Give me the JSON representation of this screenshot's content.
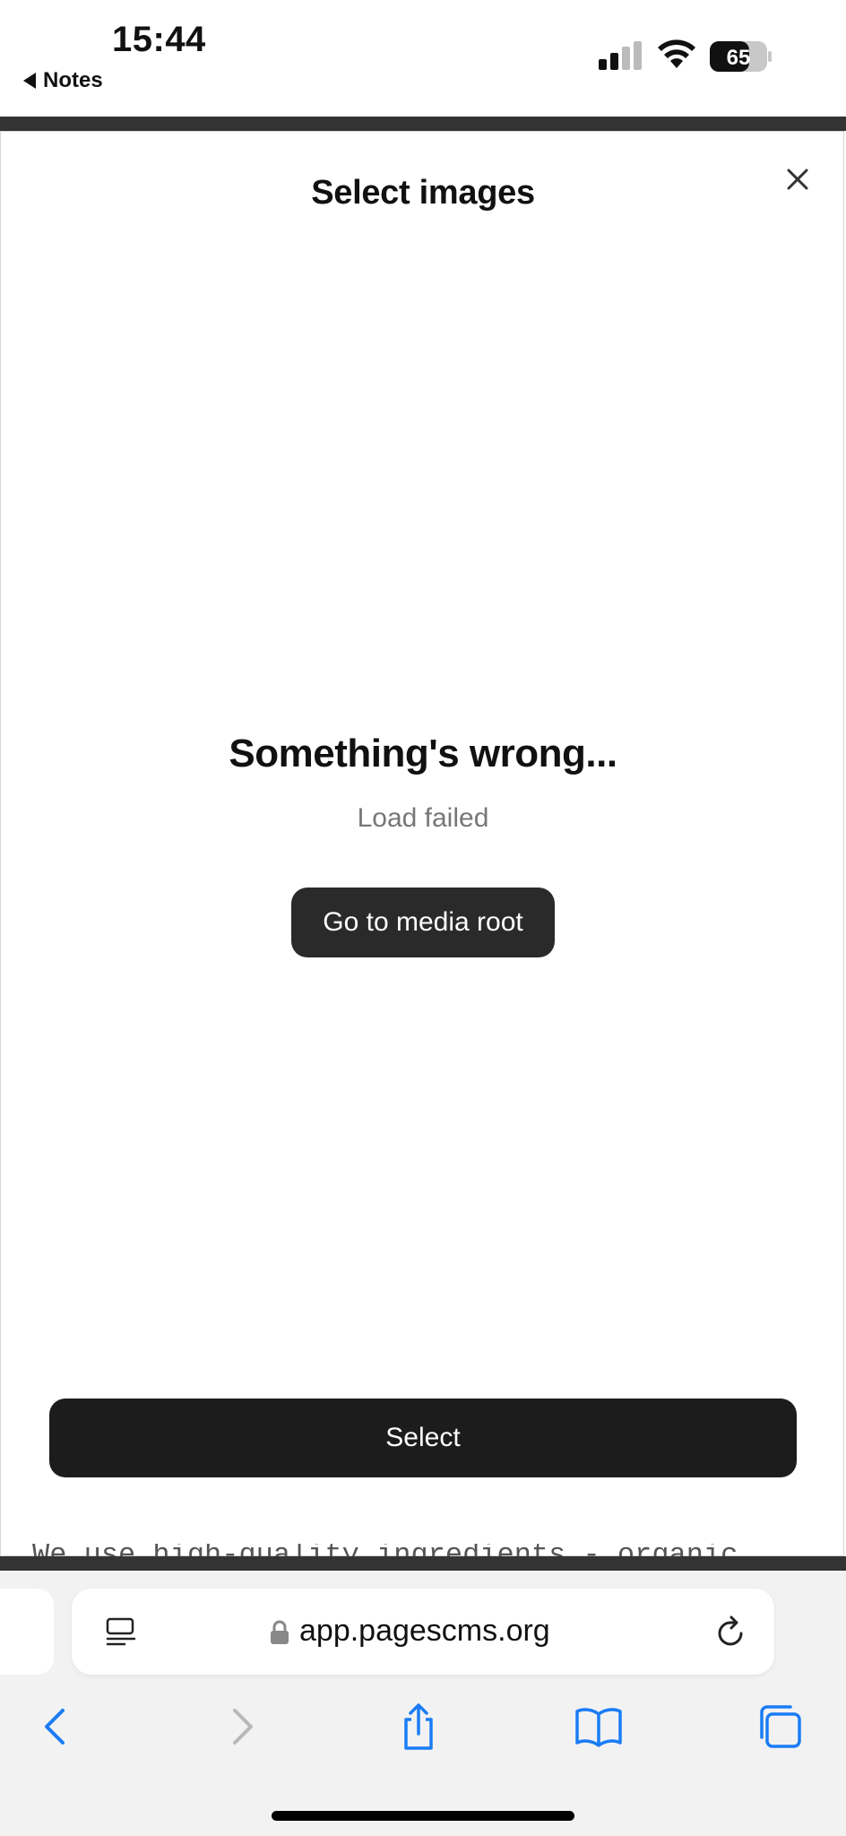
{
  "status": {
    "time": "15:44",
    "back_label": "Notes",
    "battery": "65"
  },
  "modal": {
    "title": "Select images",
    "error_title": "Something's wrong...",
    "error_message": "Load failed",
    "media_root_label": "Go to media root",
    "select_label": "Select"
  },
  "background": {
    "peek_text": "We use high-quality ingredients - organic"
  },
  "browser": {
    "url": "app.pagescms.org"
  },
  "colors": {
    "accent": "#1a7cf5",
    "button_dark": "#1c1c1c"
  },
  "icons": {
    "close": "close-icon",
    "reader": "reader-icon",
    "lock": "lock-icon",
    "reload": "reload-icon",
    "back": "back-arrow-icon",
    "forward": "forward-arrow-icon",
    "share": "share-icon",
    "bookmarks": "bookmarks-icon",
    "tabs": "tabs-icon"
  }
}
